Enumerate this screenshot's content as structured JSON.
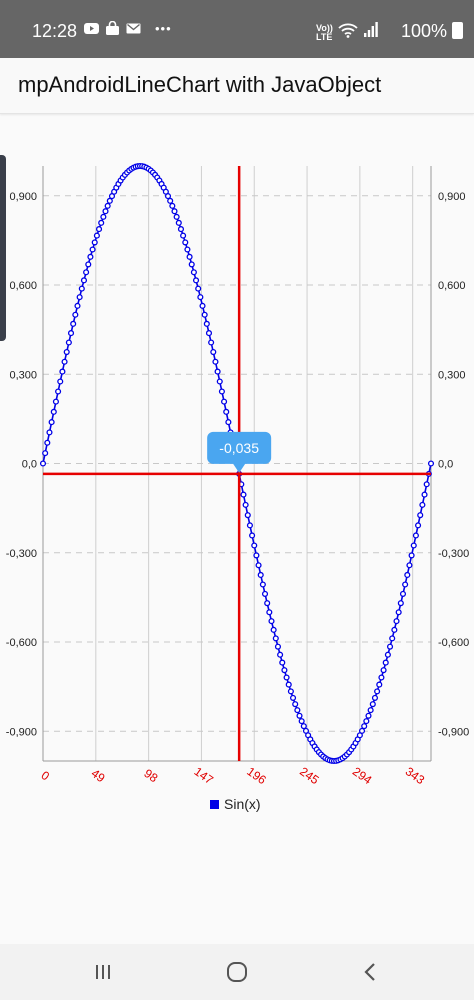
{
  "status_bar": {
    "time": "12:28",
    "left_icons": [
      "youtube-icon",
      "bag-icon",
      "mail-icon",
      "more-icon"
    ],
    "more": "•••",
    "network_label": "Vo)) LTE",
    "battery_pct": "100%"
  },
  "app_bar": {
    "title": "mpAndroidLineChart with JavaObject"
  },
  "chart_data": {
    "type": "line",
    "series": [
      {
        "name": "Sin(x)",
        "function": "sin(2*pi*x/360)",
        "x_start": 0,
        "x_end": 360,
        "x_step": 1,
        "color": "#0000e6"
      }
    ],
    "xlim": [
      0,
      360
    ],
    "ylim": [
      -1.0,
      1.0
    ],
    "y_ticks": [
      0.9,
      0.6,
      0.3,
      0.0,
      -0.3,
      -0.6,
      -0.9
    ],
    "y_tick_labels": [
      "0,900",
      "0,600",
      "0,300",
      "0,0",
      "-0,300",
      "-0,600",
      "-0,900"
    ],
    "x_ticks": [
      0,
      49,
      98,
      147,
      196,
      245,
      294,
      343
    ],
    "x_tick_labels": [
      "0",
      "49",
      "98",
      "147",
      "196",
      "245",
      "294",
      "343"
    ],
    "x_tick_color": "#e00000",
    "y_tick_color": "#222222",
    "grid": true,
    "legend": {
      "position": "bottom-center",
      "label": "Sin(x)",
      "color": "#0000e6"
    },
    "highlight": {
      "x": 182,
      "y": -0.035,
      "label": "-0,035",
      "line_color": "#e60000",
      "marker_color": "#4aa6f0"
    }
  },
  "nav_bar": {
    "recent": "recent-apps-icon",
    "home": "home-icon",
    "back": "back-icon"
  }
}
